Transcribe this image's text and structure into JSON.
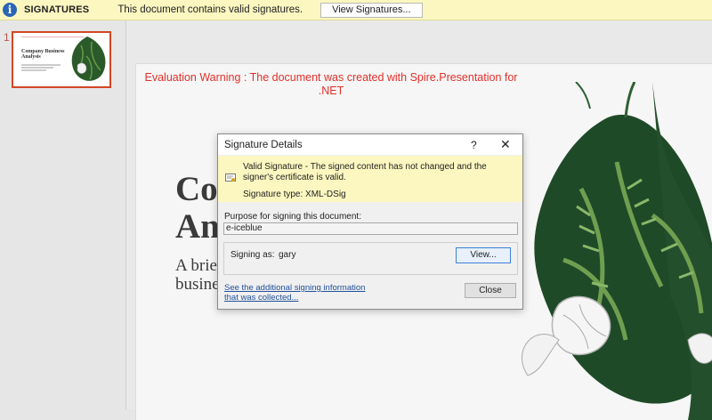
{
  "message_bar": {
    "icon": "info-icon",
    "icon_glyph": "i",
    "title": "SIGNATURES",
    "text": "This document contains valid signatures.",
    "button_label": "View Signatures...",
    "color": "#fcf7c0"
  },
  "thumbnails": [
    {
      "number": "1",
      "title": "Company Business Analysis",
      "selected": true
    }
  ],
  "slide": {
    "evaluation_warning": "Evaluation Warning : The document was created with  Spire.Presentation for .NET",
    "title": "Com\nAna",
    "subtitle": "A brief\nbusine"
  },
  "dialog": {
    "title": "Signature Details",
    "help_glyph": "?",
    "close_glyph": "✕",
    "valid_message": "Valid Signature - The signed content has not changed and the signer's certificate is valid.",
    "signature_type": "Signature type: XML-DSig",
    "purpose_label": "Purpose for signing this document:",
    "purpose_value": "e-iceblue",
    "signing_as_label": "Signing as:",
    "signing_as_value": "gary",
    "view_button": "View...",
    "info_link": "See the additional signing information that was collected...",
    "close_button": "Close"
  }
}
